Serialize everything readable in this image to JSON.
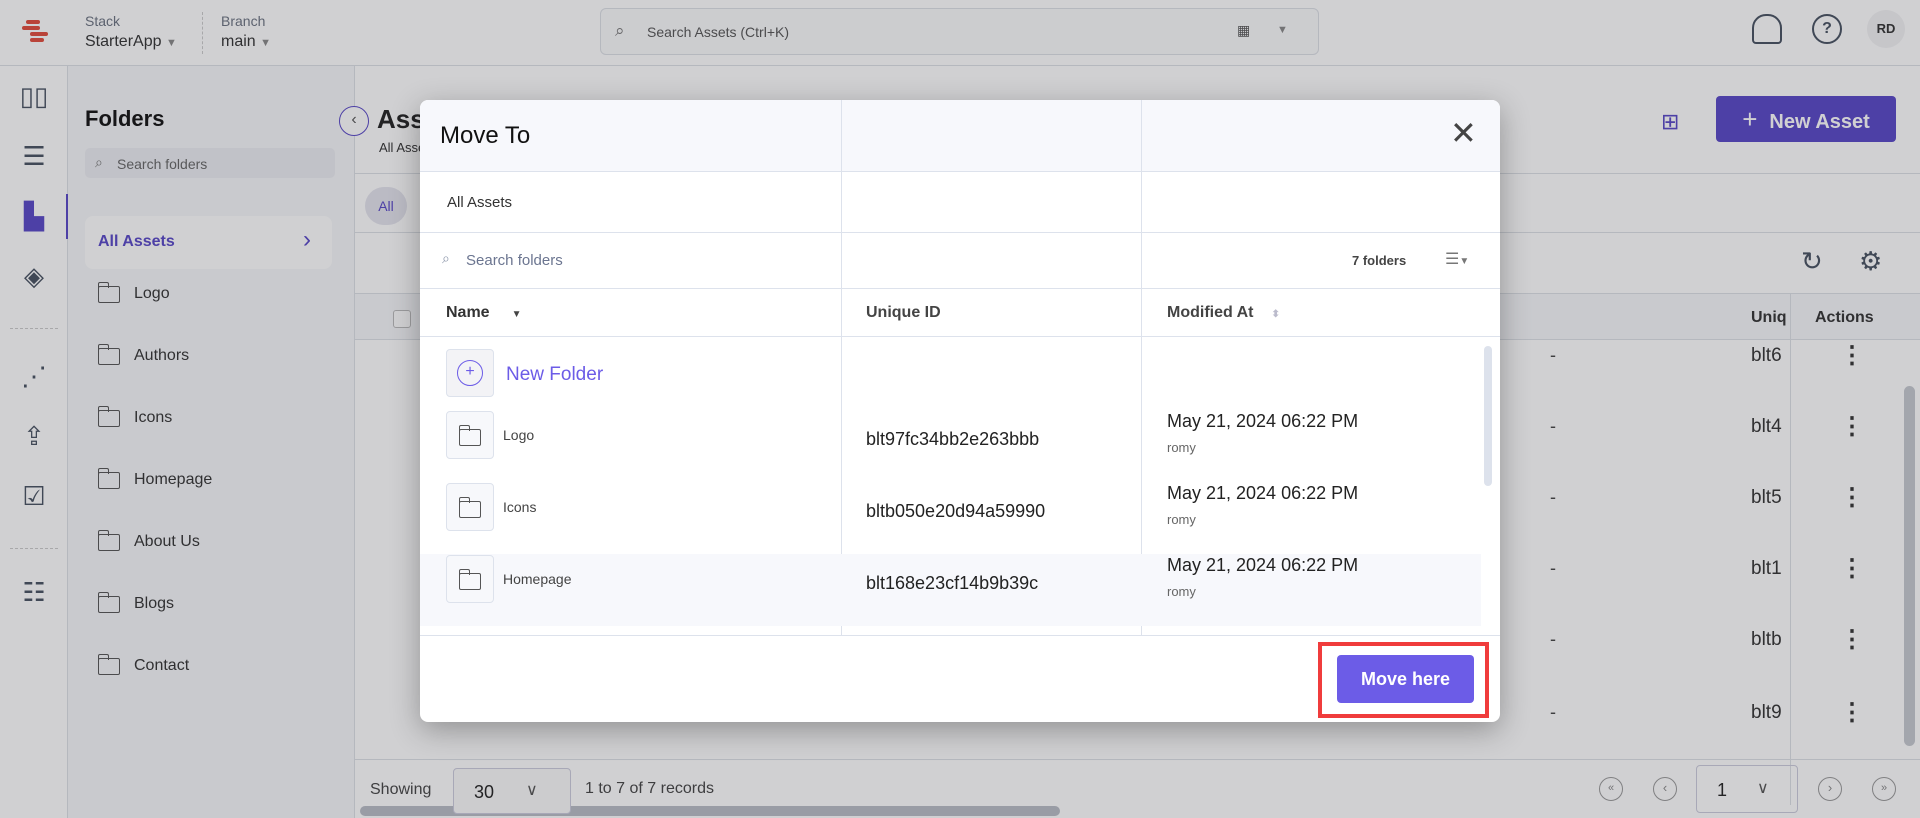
{
  "topbar": {
    "stack_label": "Stack",
    "stack_value": "StarterApp",
    "branch_label": "Branch",
    "branch_value": "main",
    "search_placeholder": "Search Assets (Ctrl+K)",
    "avatar": "RD"
  },
  "rail": {
    "icons": [
      "dashboard-icon",
      "entries-icon",
      "assets-icon",
      "layers-icon",
      "releases-icon",
      "deploy-icon",
      "tasks-icon",
      "settings-sliders-icon"
    ]
  },
  "folders": {
    "title": "Folders",
    "search_placeholder": "Search folders",
    "active": "All Assets",
    "items": [
      "Logo",
      "Authors",
      "Icons",
      "Homepage",
      "About Us",
      "Blogs",
      "Contact"
    ]
  },
  "assets": {
    "title": "Assets",
    "breadcrumb": "All Assets",
    "filter_all": "All",
    "new_asset": "New Asset",
    "col_unique": "Uniq",
    "col_actions": "Actions",
    "rows": [
      {
        "dash": "-",
        "uid": "blt6"
      },
      {
        "dash": "-",
        "uid": "blt4"
      },
      {
        "dash": "-",
        "uid": "blt5"
      },
      {
        "dash": "-",
        "uid": "blt1"
      },
      {
        "dash": "-",
        "uid": "bltb"
      },
      {
        "dash": "-",
        "uid": "blt9"
      }
    ],
    "showing_label": "Showing",
    "per_page": "30",
    "records": "1 to 7 of 7 records",
    "page": "1"
  },
  "modal": {
    "title": "Move To",
    "breadcrumb": "All Assets",
    "search_placeholder": "Search folders",
    "count": "7 folders",
    "columns": [
      "Name",
      "Unique ID",
      "Modified At"
    ],
    "new_folder": "New Folder",
    "rows": [
      {
        "name": "Logo",
        "uid": "blt97fc34bb2e263bbb",
        "modified": "May 21, 2024 06:22 PM",
        "by": "romy"
      },
      {
        "name": "Icons",
        "uid": "bltb050e20d94a59990",
        "modified": "May 21, 2024 06:22 PM",
        "by": "romy"
      },
      {
        "name": "Homepage",
        "uid": "blt168e23cf14b9b39c",
        "modified": "May 21, 2024 06:22 PM",
        "by": "romy"
      }
    ],
    "move_here": "Move here"
  },
  "colors": {
    "accent": "#6c5ce7",
    "brand": "#5847c7",
    "highlight": "#f03c3c"
  }
}
